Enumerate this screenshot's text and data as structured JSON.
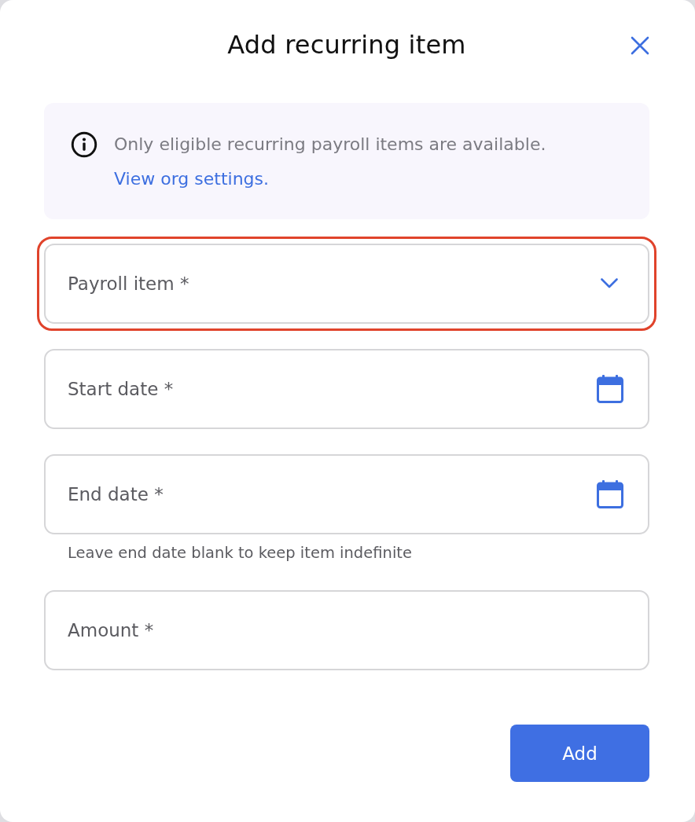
{
  "dialog": {
    "title": "Add recurring item"
  },
  "notice": {
    "text": "Only eligible recurring payroll items are available.",
    "link": "View org settings."
  },
  "fields": [
    {
      "kind": "select",
      "placeholder": "Payroll item *",
      "highlighted": true
    },
    {
      "kind": "date",
      "placeholder": "Start date *",
      "highlighted": false
    },
    {
      "kind": "date",
      "placeholder": "End date *",
      "highlighted": false,
      "helper": "Leave end date blank to keep item indefinite"
    },
    {
      "kind": "text",
      "placeholder": "Amount *",
      "highlighted": false
    }
  ],
  "buttons": [
    {
      "label": "Add"
    }
  ]
}
